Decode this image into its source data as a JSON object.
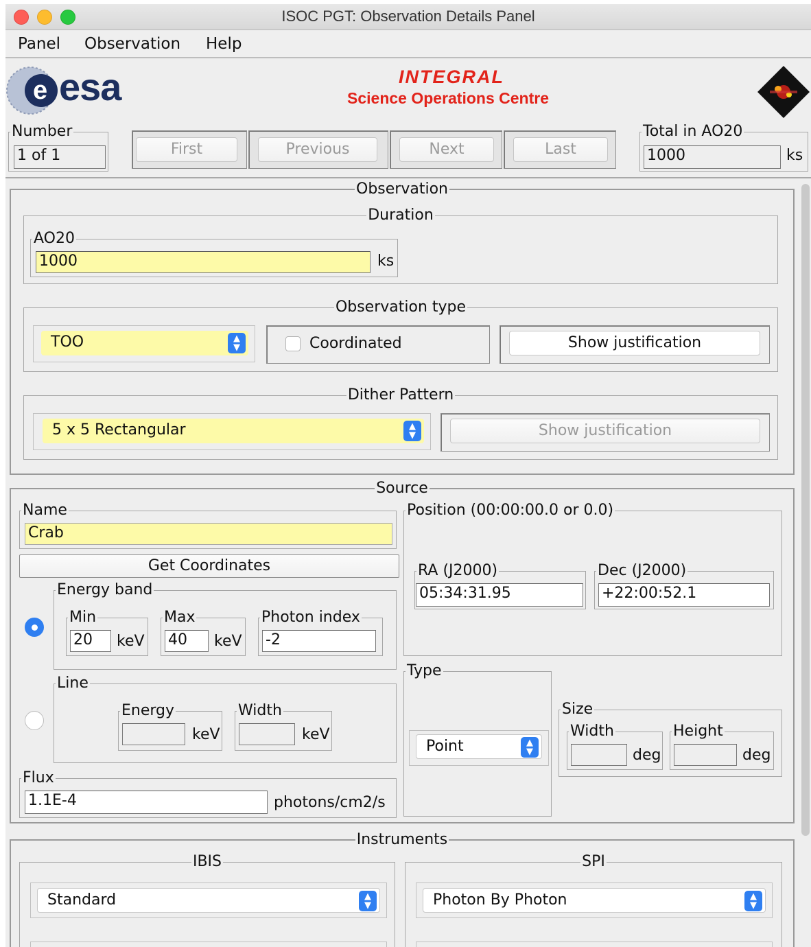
{
  "window": {
    "title": "ISOC PGT: Observation Details Panel"
  },
  "menu": [
    "Panel",
    "Observation",
    "Help"
  ],
  "header": {
    "esa_logo": "esa",
    "integral": "INTEGRAL",
    "soc": "Science Operations Centre",
    "badge_logo": "integral-mission-icon"
  },
  "nav": {
    "number_label": "Number",
    "number_value": "1 of 1",
    "first": "First",
    "previous": "Previous",
    "next": "Next",
    "last": "Last",
    "total_label": "Total in AO20",
    "total_value": "1000",
    "total_unit": "ks"
  },
  "observation": {
    "title": "Observation",
    "duration": {
      "title": "Duration",
      "ao_label": "AO20",
      "ao_value": "1000",
      "unit": "ks"
    },
    "obs_type": {
      "title": "Observation type",
      "value": "TOO",
      "coordinated": "Coordinated",
      "coordinated_checked": false,
      "show_just": "Show justification"
    },
    "dither": {
      "title": "Dither Pattern",
      "value": "5 x 5 Rectangular",
      "show_just": "Show justification"
    }
  },
  "source": {
    "title": "Source",
    "name_label": "Name",
    "name_value": "Crab",
    "get_coords": "Get Coordinates",
    "energy": {
      "title": "Energy band",
      "selected": true,
      "min_label": "Min",
      "min_value": "20",
      "max_label": "Max",
      "max_value": "40",
      "unit": "keV",
      "photon_label": "Photon index",
      "photon_value": "-2"
    },
    "line": {
      "title": "Line",
      "selected": false,
      "energy_label": "Energy",
      "width_label": "Width",
      "unit": "keV"
    },
    "flux": {
      "label": "Flux",
      "value": "1.1E-4",
      "unit": "photons/cm2/s"
    },
    "position": {
      "title": "Position (00:00:00.0 or 0.0)",
      "ra_label": "RA (J2000)",
      "ra_value": "05:34:31.95",
      "dec_label": "Dec (J2000)",
      "dec_value": "+22:00:52.1"
    },
    "type": {
      "title": "Type",
      "value": "Point"
    },
    "size": {
      "title": "Size",
      "width_label": "Width",
      "height_label": "Height",
      "unit": "deg"
    }
  },
  "instruments": {
    "title": "Instruments",
    "ibis": {
      "title": "IBIS",
      "value": "Standard"
    },
    "spi": {
      "title": "SPI",
      "value": "Photon By Photon"
    }
  }
}
